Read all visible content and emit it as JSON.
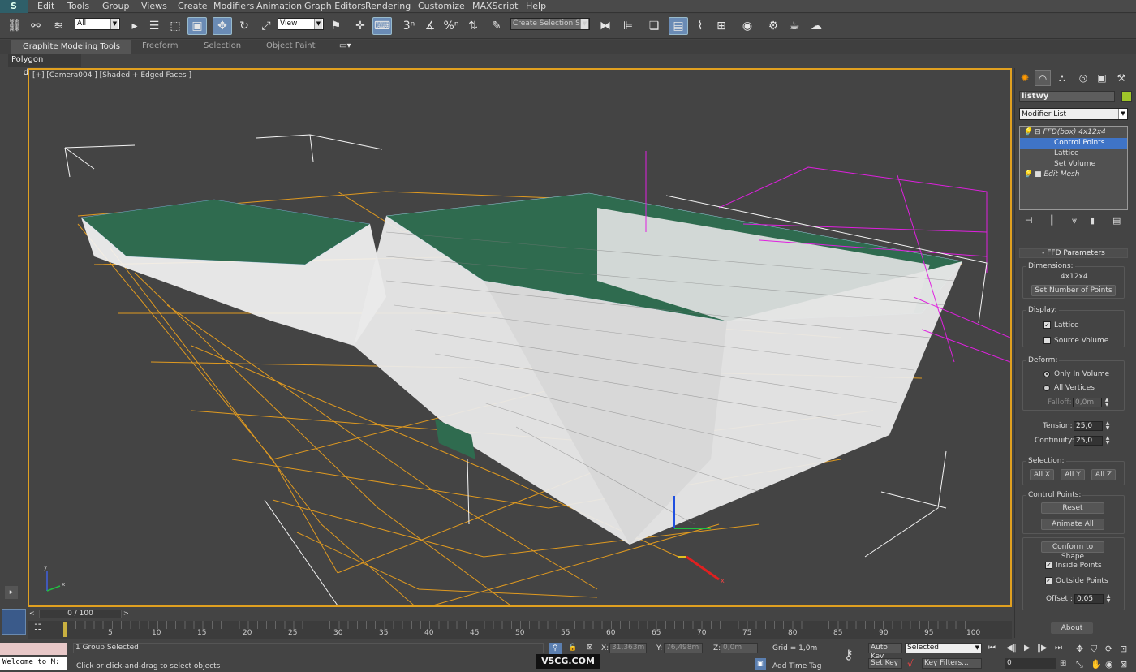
{
  "app": {
    "logo": "S"
  },
  "menu": [
    "Edit",
    "Tools",
    "Group",
    "Views",
    "Create",
    "Modifiers",
    "Animation",
    "Graph Editors",
    "Rendering",
    "Customize",
    "MAXScript",
    "Help"
  ],
  "toolbar": {
    "selection_filter": "All",
    "reference_coord": "View",
    "named_selection_set": "Create Selection Se",
    "snap_3": "3",
    "percent_snap": "%"
  },
  "ribbon": {
    "tabs": [
      "Graphite Modeling Tools",
      "Freeform",
      "Selection",
      "Object Paint"
    ],
    "panel": "Polygon Modeling"
  },
  "viewport": {
    "label": "[+] [Camera004 ] [Shaded + Edged Faces ]",
    "axis_x": "x",
    "axis_tripod_x": "x",
    "axis_tripod_y": "y"
  },
  "command_panel": {
    "object_name": "listwy",
    "modifier_list": "Modifier List",
    "stack": [
      {
        "label": "FFD(box) 4x12x4",
        "type": "mod"
      },
      {
        "label": "Control Points",
        "type": "sub",
        "selected": true
      },
      {
        "label": "Lattice",
        "type": "sub"
      },
      {
        "label": "Set Volume",
        "type": "sub"
      },
      {
        "label": "Edit Mesh",
        "type": "mod"
      }
    ],
    "ffd": {
      "title": "FFD Parameters",
      "dimensions_label": "Dimensions:",
      "dimensions_value": "4x12x4",
      "set_points_btn": "Set Number of Points",
      "display_label": "Display:",
      "lattice": "Lattice",
      "source_volume": "Source Volume",
      "deform_label": "Deform:",
      "only_in_volume": "Only In Volume",
      "all_vertices": "All Vertices",
      "falloff_label": "Falloff:",
      "falloff_value": "0,0m",
      "tension_label": "Tension:",
      "tension_value": "25,0",
      "continuity_label": "Continuity:",
      "continuity_value": "25,0",
      "selection_label": "Selection:",
      "all_x": "All X",
      "all_y": "All Y",
      "all_z": "All Z",
      "control_points_label": "Control Points:",
      "reset": "Reset",
      "animate_all": "Animate All",
      "conform_to_shape": "Conform to Shape",
      "inside_points": "Inside Points",
      "outside_points": "Outside Points",
      "offset_label": "Offset :",
      "offset_value": "0,05",
      "about": "About"
    }
  },
  "timeline": {
    "frame_display": "0 / 100",
    "ticks": [
      "5",
      "10",
      "15",
      "20",
      "25",
      "30",
      "35",
      "40",
      "45",
      "50",
      "55",
      "60",
      "65",
      "70",
      "75",
      "80",
      "85",
      "90",
      "95",
      "100"
    ]
  },
  "status": {
    "listener_text": "Welcome to M:",
    "selection_status": "1 Group Selected",
    "prompt": "Click or click-and-drag to select objects",
    "x_label": "X:",
    "x_value": "31,363m",
    "y_label": "Y:",
    "y_value": "76,498m",
    "z_label": "Z:",
    "z_value": "0,0m",
    "grid": "Grid = 1,0m",
    "auto_key": "Auto Key",
    "key_mode": "Selected",
    "set_key": "Set Key",
    "key_filters": "Key Filters...",
    "add_time_tag": "Add Time Tag",
    "frame": "0"
  },
  "watermark": "V5CG.COM",
  "colors": {
    "accent_active": "#6a8bb5",
    "viewport_border": "#e0a020",
    "lattice": "#f0a020",
    "mesh_green": "#2f6b4f",
    "magenta": "#e020e0",
    "selected_item": "#3f74c7"
  }
}
